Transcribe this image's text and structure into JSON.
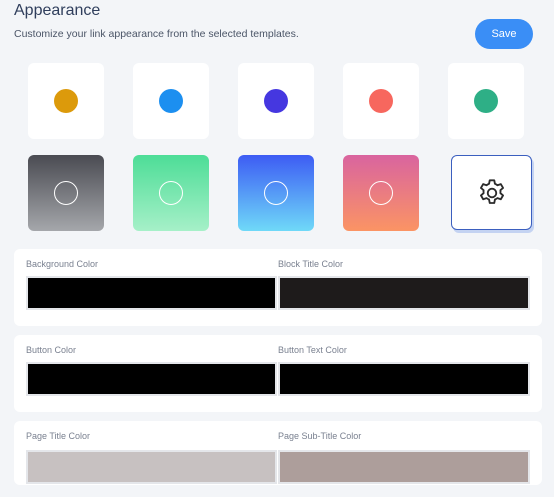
{
  "header": {
    "title": "Appearance",
    "subtitle": "Customize your link appearance from the selected templates.",
    "save_label": "Save"
  },
  "solid_templates": [
    {
      "color": "#dc9a0b"
    },
    {
      "color": "#1c8ff0"
    },
    {
      "color": "#4537e0"
    },
    {
      "color": "#f7675e"
    },
    {
      "color": "#2eaf86"
    }
  ],
  "gradient_templates": [
    {
      "from": "#4a4b52",
      "to": "#a5a7ab"
    },
    {
      "from": "#4ddd97",
      "to": "#a6f0c8"
    },
    {
      "from": "#3d5cf4",
      "to": "#6fd9f8"
    },
    {
      "from": "#d9649f",
      "to": "#fb9464"
    }
  ],
  "custom_template": {
    "icon": "gear-icon"
  },
  "color_settings": {
    "background_color": {
      "label": "Background Color",
      "value": "#000000"
    },
    "block_title_color": {
      "label": "Block Title Color",
      "value": "#1e1b1b"
    },
    "button_color": {
      "label": "Button Color",
      "value": "#000000"
    },
    "button_text_color": {
      "label": "Button Text Color",
      "value": "#000000"
    },
    "page_title_color": {
      "label": "Page Title Color",
      "value": "#c7c1c1"
    },
    "page_subtitle_color": {
      "label": "Page Sub-Title Color",
      "value": "#ad9e9b"
    }
  }
}
